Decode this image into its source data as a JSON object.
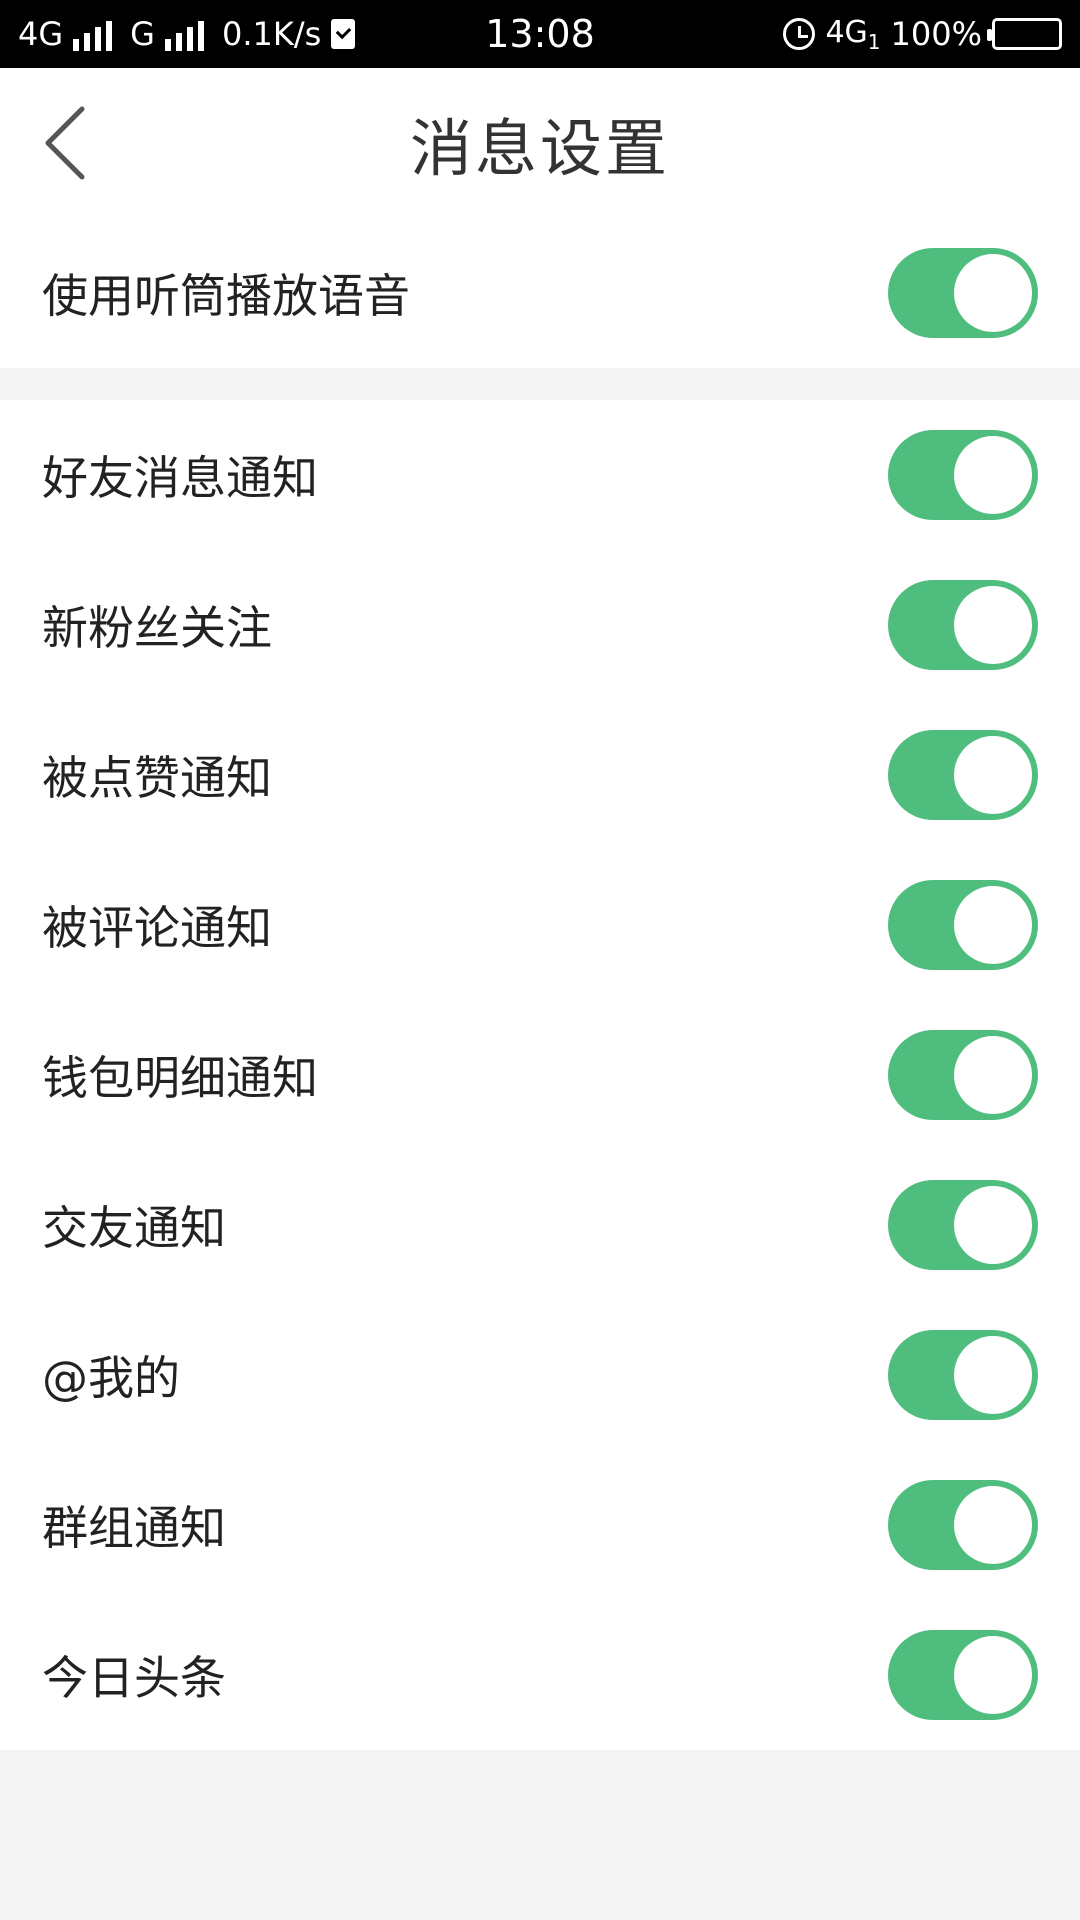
{
  "status_bar": {
    "network1": "4G",
    "network2": "G",
    "speed": "0.1K/s",
    "time": "13:08",
    "network3": "4G",
    "network3_sub": "1",
    "battery": "100%"
  },
  "header": {
    "title": "消息设置"
  },
  "settings": {
    "top": [
      {
        "label": "使用听筒播放语音",
        "on": true
      }
    ],
    "main": [
      {
        "label": "好友消息通知",
        "on": true
      },
      {
        "label": "新粉丝关注",
        "on": true
      },
      {
        "label": "被点赞通知",
        "on": true
      },
      {
        "label": "被评论通知",
        "on": true
      },
      {
        "label": "钱包明细通知",
        "on": true
      },
      {
        "label": "交友通知",
        "on": true
      },
      {
        "label": "@我的",
        "on": true
      },
      {
        "label": "群组通知",
        "on": true
      },
      {
        "label": "今日头条",
        "on": true
      }
    ]
  },
  "colors": {
    "toggle_on": "#4fbd7d",
    "background": "#f4f4f4"
  }
}
